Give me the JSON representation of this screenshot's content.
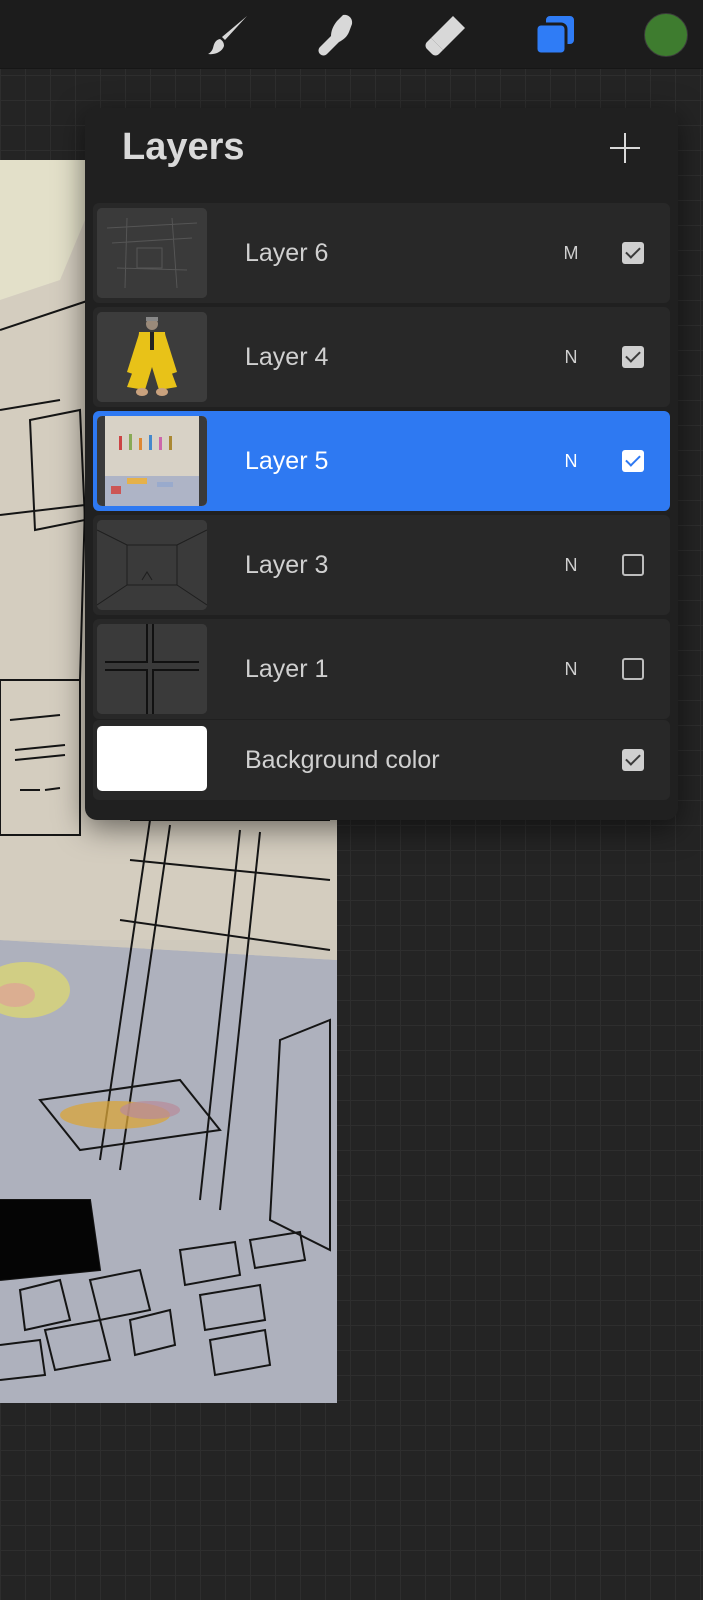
{
  "toolbar": {
    "tools": [
      {
        "name": "brush",
        "icon": "paintbrush-icon",
        "active": false
      },
      {
        "name": "smudge",
        "icon": "smudge-finger-icon",
        "active": false
      },
      {
        "name": "eraser",
        "icon": "eraser-icon",
        "active": false
      },
      {
        "name": "layers",
        "icon": "layers-icon",
        "active": true
      }
    ],
    "active_tool_color": "#2f7cf6",
    "current_color": "#3e7c2f"
  },
  "layers_panel": {
    "title": "Layers",
    "add_icon": "plus-icon",
    "layers": [
      {
        "name": "Layer 6",
        "blend": "M",
        "visible": true,
        "selected": false
      },
      {
        "name": "Layer 4",
        "blend": "N",
        "visible": true,
        "selected": false
      },
      {
        "name": "Layer 5",
        "blend": "N",
        "visible": true,
        "selected": true
      },
      {
        "name": "Layer 3",
        "blend": "N",
        "visible": false,
        "selected": false
      },
      {
        "name": "Layer 1",
        "blend": "N",
        "visible": false,
        "selected": false
      }
    ],
    "background": {
      "name": "Background color",
      "color": "#ffffff",
      "visible": true
    },
    "selected_color": "#2e79f2"
  }
}
